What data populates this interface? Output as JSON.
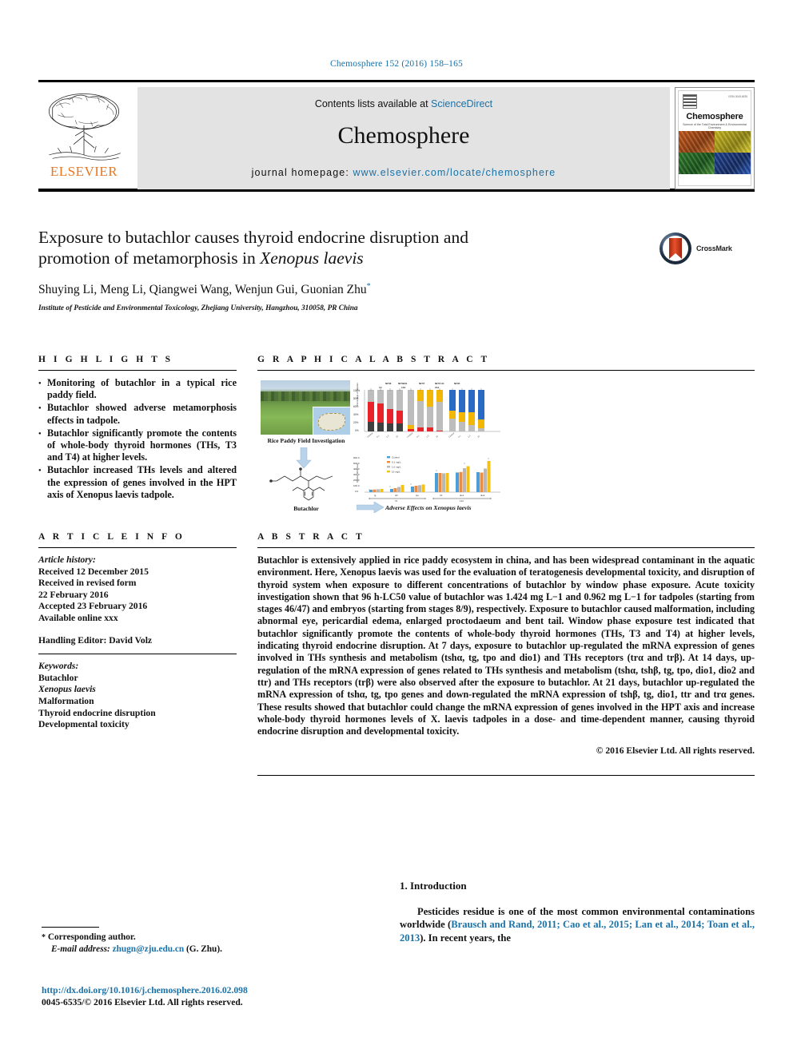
{
  "running_head": "Chemosphere 152 (2016) 158–165",
  "masthead": {
    "contents_prefix": "Contents lists available at ",
    "sciencedirect": "ScienceDirect",
    "journal_title": "Chemosphere",
    "homepage_prefix": "journal homepage: ",
    "homepage_url": "www.elsevier.com/locate/chemosphere",
    "publisher": "ELSEVIER",
    "cover": {
      "title": "Chemosphere",
      "subtitle": "Science of the Total Environment & Environmental Chemistry",
      "issn": "ISSN 0045-6535"
    }
  },
  "article": {
    "title_line1": "Exposure to butachlor causes thyroid endocrine disruption and",
    "title_line2_a": "promotion of metamorphosis in ",
    "title_line2_italic": "Xenopus laevis",
    "authors": "Shuying Li, Meng Li, Qiangwei Wang, Wenjun Gui, Guonian Zhu",
    "author_marker": "*",
    "affiliation": "Institute of Pesticide and Environmental Toxicology, Zhejiang University, Hangzhou, 310058, PR China",
    "crossmark_label": "CrossMark"
  },
  "highlights": {
    "heading": "H I G H L I G H T S",
    "items": [
      "Monitoring of butachlor in a typical rice paddy field.",
      "Butachlor showed adverse metamorphosis effects in tadpole.",
      "Butachlor significantly promote the contents of whole-body thyroid hormones (THs, T3 and T4) at higher levels.",
      "Butachlor increased THs levels and altered the expression of genes involved in the HPT axis of Xenopus laevis tadpole."
    ]
  },
  "graphical_abstract": {
    "heading": "G R A P H I C A L  A B S T R A C T",
    "caption_photo": "Rice Paddy Field Investigation",
    "caption_compound": "Butachlor",
    "caption_effects": "Adverse Effects on Xenopus laevis"
  },
  "chart_data": [
    {
      "type": "bar",
      "stacked": true,
      "title": "",
      "ylabel": "Percentage of tadpoles",
      "xlabel": "",
      "ylim": [
        0,
        100
      ],
      "yticks": [
        "0%",
        "20%",
        "40%",
        "60%",
        "80%",
        "100%"
      ],
      "annotations": [
        "NF58",
        "NF59/61",
        "NF57",
        "NF57-61",
        "NF65"
      ],
      "group_markers": [
        "7d",
        "14d",
        "21d"
      ],
      "categories": [
        "Control",
        "0.1",
        "1.0",
        "10",
        "Control",
        "0.1",
        "1.0",
        "10",
        "Control",
        "0.1",
        "1.0",
        "10"
      ],
      "series": [
        {
          "name": "stage-low",
          "color": "#3f3f3f",
          "values": [
            22,
            20,
            18,
            20,
            4,
            6,
            5,
            2,
            2,
            2,
            1,
            1
          ]
        },
        {
          "name": "stage-red",
          "color": "#e8232a",
          "values": [
            48,
            46,
            34,
            30,
            6,
            9,
            9,
            2,
            0,
            0,
            0,
            0
          ]
        },
        {
          "name": "stage-grey",
          "color": "#bdbdbd",
          "values": [
            30,
            34,
            48,
            50,
            82,
            60,
            48,
            70,
            30,
            22,
            16,
            8
          ]
        },
        {
          "name": "stage-yellow",
          "color": "#f2b705",
          "values": [
            0,
            0,
            0,
            0,
            8,
            25,
            38,
            26,
            18,
            22,
            30,
            21
          ]
        },
        {
          "name": "stage-blue",
          "color": "#2a69c4",
          "values": [
            0,
            0,
            0,
            0,
            0,
            0,
            0,
            0,
            50,
            54,
            53,
            70
          ]
        }
      ]
    },
    {
      "type": "bar",
      "stacked": false,
      "title": "",
      "ylabel": "Relative mRNA level",
      "xlabel": "",
      "ylim": [
        0,
        600
      ],
      "yticks": [
        "0.0",
        "100.0",
        "200.0",
        "300.0",
        "400.0",
        "500.0",
        "600.0"
      ],
      "group_markers": [
        "7d",
        "14d"
      ],
      "categories": [
        "tg",
        "tshb",
        "tpo",
        "trb",
        "dio1",
        "dio2"
      ],
      "legend": [
        "Control",
        "0.1 mg/L",
        "1.0 mg/L",
        "10 mg/L"
      ],
      "legend_colors": [
        "#4a9fd8",
        "#ef8b3c",
        "#b8b8b8",
        "#f2c11b"
      ],
      "series": [
        {
          "name": "Control",
          "color": "#4a9fd8",
          "values": [
            40,
            55,
            95,
            330,
            345,
            360
          ]
        },
        {
          "name": "0.1 mg/L",
          "color": "#ef8b3c",
          "values": [
            45,
            70,
            110,
            330,
            360,
            350
          ]
        },
        {
          "name": "1.0 mg/L",
          "color": "#b8b8b8",
          "values": [
            50,
            90,
            120,
            325,
            430,
            430
          ]
        },
        {
          "name": "10 mg/L",
          "color": "#f2c11b",
          "values": [
            55,
            125,
            135,
            330,
            465,
            560
          ]
        }
      ]
    }
  ],
  "article_info": {
    "heading": "A R T I C L E  I N F O",
    "history_label": "Article history:",
    "history_lines": [
      "Received 12 December 2015",
      "Received in revised form",
      "22 February 2016",
      "Accepted 23 February 2016",
      "Available online xxx"
    ],
    "handling_editor": "Handling Editor: David Volz",
    "keywords_label": "Keywords:",
    "keywords": [
      "Butachlor",
      "Xenopus laevis",
      "Malformation",
      "Thyroid endocrine disruption",
      "Developmental toxicity"
    ]
  },
  "abstract": {
    "heading": "A B S T R A C T",
    "p1": "Butachlor is extensively applied in rice paddy ecosystem in china, and has been widespread contaminant in the aquatic environment. Here, Xenopus laevis was used for the evaluation of teratogenesis developmental toxicity, and disruption of thyroid system when exposure to different concentrations of butachlor by window phase exposure. Acute toxicity investigation shown that 96 h-LC50 value of butachlor was 1.424 mg L−1 and 0.962 mg L−1 for tadpoles (starting from stages 46/47) and embryos (starting from stages 8/9), respectively. Exposure to butachlor caused malformation, including abnormal eye, pericardial edema, enlarged proctodaeum and bent tail. Window phase exposure test indicated that butachlor significantly promote the contents of whole-body thyroid hormones (THs, T3 and T4) at higher levels, indicating thyroid endocrine disruption. At 7 days, exposure to butachlor up-regulated the mRNA expression of genes involved in THs synthesis and metabolism (tshα, tg, tpo and dio1) and THs receptors (trα and trβ). At 14 days, up-regulation of the mRNA expression of genes related to THs synthesis and metabolism (tshα, tshβ, tg, tpo, dio1, dio2 and ttr) and THs receptors (trβ) were also observed after the exposure to butachlor. At 21 days, butachlor up-regulated the mRNA expression of tshα, tg, tpo genes and down-regulated the mRNA expression of tshβ, tg, dio1, ttr and trα genes. These results showed that butachlor could change the mRNA expression of genes involved in the HPT axis and increase whole-body thyroid hormones levels of X. laevis tadpoles in a dose- and time-dependent manner, causing thyroid endocrine disruption and developmental toxicity.",
    "copyright": "© 2016 Elsevier Ltd. All rights reserved."
  },
  "introduction": {
    "heading": "1. Introduction",
    "paragraph_a": "Pesticides residue is one of the most common environmental contaminations worldwide (",
    "citation": "Brausch and Rand, 2011; Cao et al., 2015; Lan et al., 2014; Toan et al., 2013",
    "paragraph_b": "). In recent years, the"
  },
  "footer": {
    "corresponding_star": "*",
    "corresponding_label": "Corresponding author.",
    "email_label": "E-mail address:",
    "email": "zhugn@zju.edu.cn",
    "email_suffix": "(G. Zhu).",
    "doi": "http://dx.doi.org/10.1016/j.chemosphere.2016.02.098",
    "issn_line": "0045-6535/© 2016 Elsevier Ltd. All rights reserved."
  }
}
